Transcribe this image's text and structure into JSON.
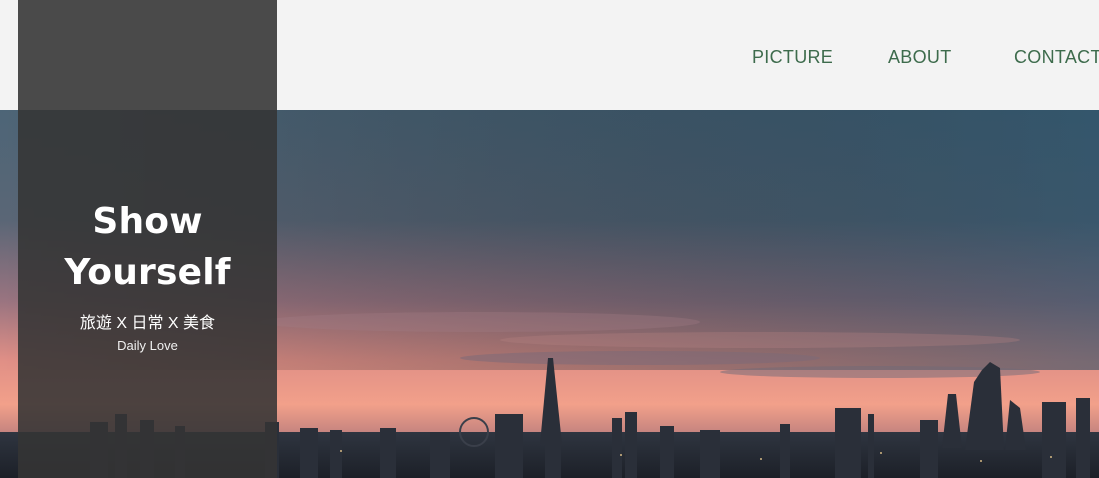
{
  "nav": {
    "items": [
      {
        "label": "PICTURE"
      },
      {
        "label": "ABOUT"
      },
      {
        "label": "CONTACT"
      }
    ]
  },
  "brand": {
    "title_line1": "Show",
    "title_line2": "Yourself",
    "subtitle": "旅遊 X 日常 X 美食",
    "tagline": "Daily Love"
  },
  "colors": {
    "nav_text": "#3d6b4c",
    "header_bg": "#f3f3f3",
    "panel_bg": "#343434"
  },
  "hero": {
    "image": "city-skyline-sunset"
  }
}
